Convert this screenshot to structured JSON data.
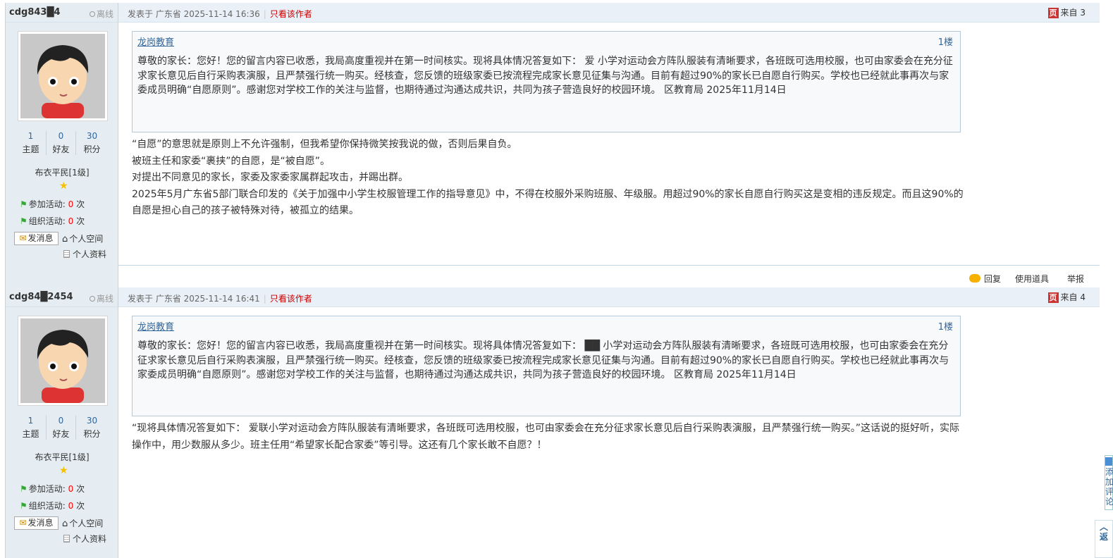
{
  "posts": [
    {
      "username": "cdg843█4",
      "status": "离线",
      "stats": [
        {
          "value": "1",
          "label": "主题"
        },
        {
          "value": "0",
          "label": "好友"
        },
        {
          "value": "30",
          "label": "积分"
        }
      ],
      "rank": "布衣平民[1级]",
      "activities": [
        {
          "label": "参加活动:",
          "value": "0",
          "unit": " 次"
        },
        {
          "label": "组织活动:",
          "value": "0",
          "unit": " 次"
        }
      ],
      "message_button": "发消息",
      "personal_space": "个人空间",
      "personal_profile": "个人资料",
      "posted_at": "发表于 广东省 2025-11-14 16:36",
      "only_author": "只看该作者",
      "from_label": "来自 3",
      "quote": {
        "author": "龙岗教育",
        "floor": "1楼",
        "text": "尊敬的家长：您好！您的留言内容已收悉，我局高度重视并在第一时间核实。现将具体情况答复如下：  爱  小学对运动会方阵队服装有清晰要求，各班既可选用校服，也可由家委会在充分征求家长意见后自行采购表演服，且严禁强行统一购买。经核查，您反馈的班级家委已按流程完成家长意见征集与沟通。目前有超过90%的家长已自愿自行购买。学校也已经就此事再次与家委成员明确“自愿原则”。感谢您对学校工作的关注与监督，也期待通过沟通达成共识，共同为孩子营造良好的校园环境。 区教育局 2025年11月14日"
      },
      "body": [
        "“自愿”的意思就是原则上不允许强制，但我希望你保持微笑按我说的做，否则后果自负。",
        "被班主任和家委“裹挟”的自愿，是“被自愿”。",
        "对提出不同意见的家长，家委及家委家属群起攻击，并踢出群。",
        "2025年5月广东省5部门联合印发的《关于加强中小学生校服管理工作的指导意见》中，不得在校服外采购班服、年级服。用超过90%的家长自愿自行购买这是变相的违反规定。而且这90%的自愿是担心自己的孩子被特殊对待，被孤立的结果。"
      ],
      "footer": {
        "reply": "回复",
        "tools": "使用道具",
        "report": "举报"
      }
    },
    {
      "username": "cdg84█2454",
      "status": "离线",
      "stats": [
        {
          "value": "1",
          "label": "主题"
        },
        {
          "value": "0",
          "label": "好友"
        },
        {
          "value": "30",
          "label": "积分"
        }
      ],
      "rank": "布衣平民[1级]",
      "activities": [
        {
          "label": "参加活动:",
          "value": "0",
          "unit": " 次"
        },
        {
          "label": "组织活动:",
          "value": "0",
          "unit": " 次"
        }
      ],
      "message_button": "发消息",
      "personal_space": "个人空间",
      "personal_profile": "个人资料",
      "posted_at": "发表于 广东省 2025-11-14 16:41",
      "only_author": "只看该作者",
      "from_label": "来自 4",
      "quote": {
        "author": "龙岗教育",
        "floor": "1楼",
        "text": "尊敬的家长：您好！您的留言内容已收悉，我局高度重视并在第一时间核实。现将具体情况答复如下：    ██  小学对运动会方阵队服装有清晰要求，各班既可选用校服，也可由家委会在充分征求家长意见后自行采购表演服，且严禁强行统一购买。经核查，您反馈的班级家委已按流程完成家长意见征集与沟通。目前有超过90%的家长已自愿自行购买。学校也已经就此事再次与家委成员明确“自愿原则”。感谢您对学校工作的关注与监督，也期待通过沟通达成共识，共同为孩子营造良好的校园环境。 区教育局 2025年11月14日"
      },
      "body": [
        "“现将具体情况答复如下：  爱联小学对运动会方阵队服装有清晰要求，各班既可选用校服，也可由家委会在充分征求家长意见后自行采购表演服，且严禁强行统一购买。”这话说的挺好听，实际操作中，用少数服从多少。班主任用“希望家长配合家委”等引导。这还有几个家长敢不自愿？！"
      ]
    }
  ],
  "sidebar_tab": "添加评论",
  "back_to_top": "返"
}
